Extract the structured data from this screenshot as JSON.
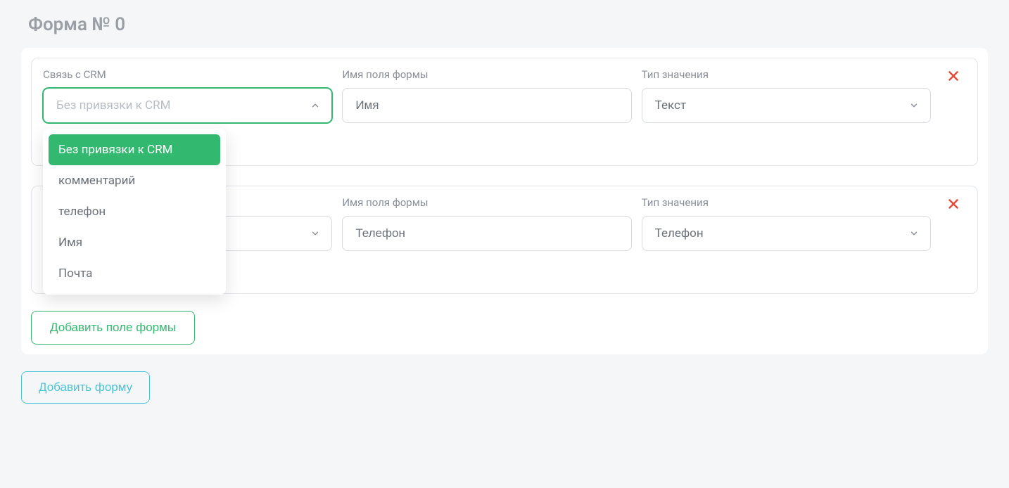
{
  "page_title": "Форма № 0",
  "labels": {
    "crm_link": "Связь с CRM",
    "field_name": "Имя поля формы",
    "value_type": "Тип значения"
  },
  "rows": [
    {
      "crm_value": "Без привязки к CRM",
      "name_value": "Имя",
      "type_value": "Текст",
      "crm_open": true,
      "toggle_on": true
    },
    {
      "crm_value": "",
      "name_value": "Телефон",
      "type_value": "Телефон",
      "crm_open": false,
      "toggle_on": true
    }
  ],
  "crm_options": [
    "Без привязки к CRM",
    "комментарий",
    "телефон",
    "Имя",
    "Почта"
  ],
  "buttons": {
    "add_field": "Добавить поле формы",
    "add_form": "Добавить форму"
  }
}
